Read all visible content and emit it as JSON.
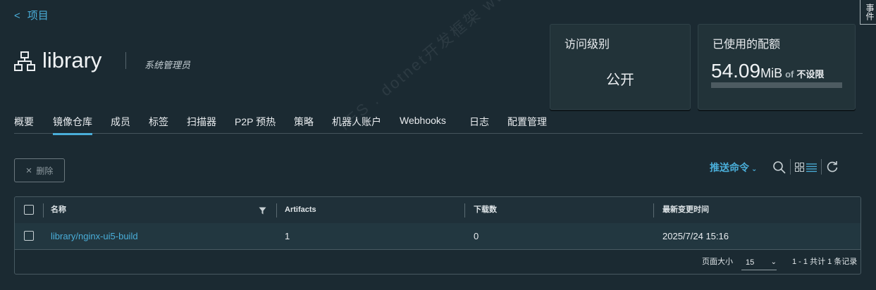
{
  "nav": {
    "back_chevron": "<",
    "back_label": "项目"
  },
  "project": {
    "icon": "project-tree-icon",
    "name": "library",
    "role": "系统管理员"
  },
  "side_tab": {
    "label": "事件"
  },
  "cards": {
    "access": {
      "title": "访问级别",
      "value": "公开"
    },
    "quota": {
      "title": "已使用的配额",
      "used_number": "54.09",
      "used_unit": "MiB",
      "of": "of",
      "limit": "不设限",
      "fill_fraction": 0.0
    }
  },
  "tabs": [
    {
      "label": "概要",
      "active": false
    },
    {
      "label": "镜像仓库",
      "active": true
    },
    {
      "label": "成员",
      "active": false
    },
    {
      "label": "标签",
      "active": false
    },
    {
      "label": "扫描器",
      "active": false
    },
    {
      "label": "P2P 预热",
      "active": false
    },
    {
      "label": "策略",
      "active": false
    },
    {
      "label": "机器人账户",
      "active": false
    },
    {
      "label": "Webhooks",
      "active": false
    },
    {
      "label": "日志",
      "active": false
    },
    {
      "label": "配置管理",
      "active": false
    }
  ],
  "toolbar": {
    "delete_label": "删除",
    "push_command_label": "推送命令"
  },
  "table": {
    "columns": [
      "名称",
      "Artifacts",
      "下载数",
      "最新变更时间"
    ],
    "rows": [
      {
        "name": "library/nginx-ui5-build",
        "artifacts": "1",
        "downloads": "0",
        "updated": "2025/7/24 15:16"
      }
    ],
    "footer": {
      "page_size_label": "页面大小",
      "page_size": "15",
      "summary": "1 - 1 共计 1 条记录"
    }
  },
  "watermark": "YES . dotnet开发框架 www.yesdotnet.com",
  "colors": {
    "accent": "#4aaed9",
    "background": "#1b2a32",
    "card": "#223339"
  }
}
